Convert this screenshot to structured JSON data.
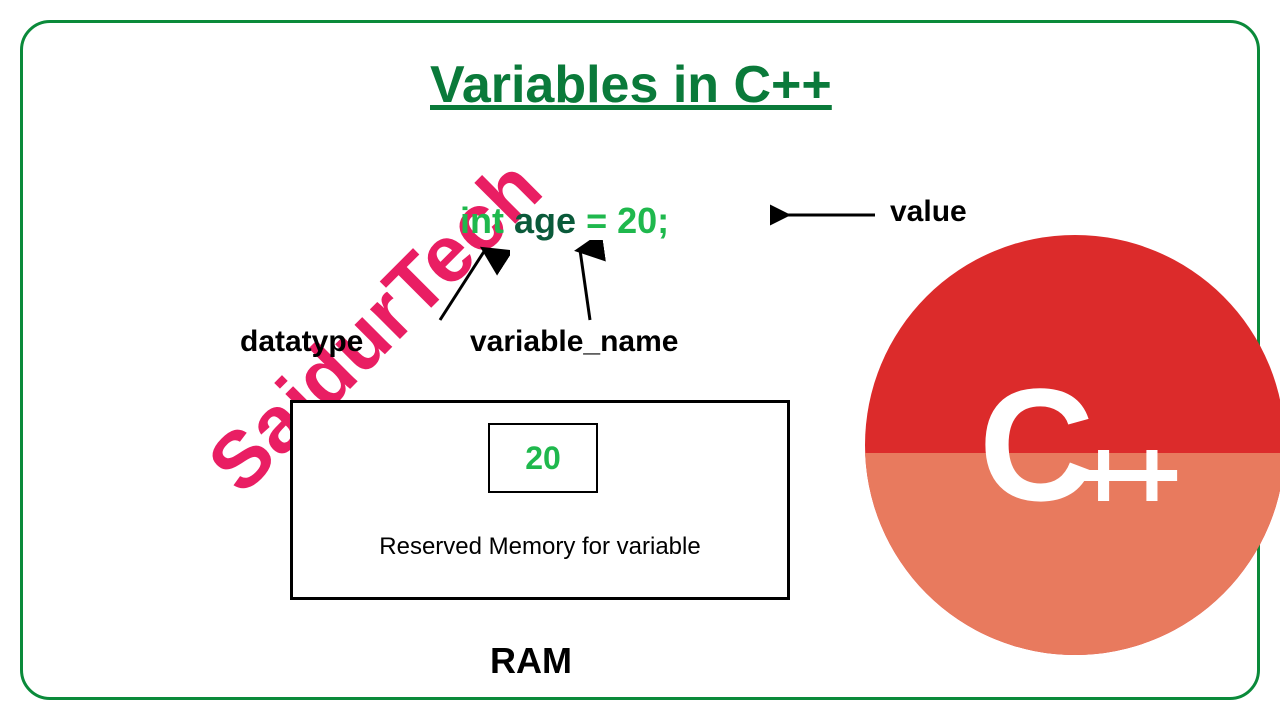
{
  "branding": {
    "watermark": "SaidurTech"
  },
  "title": "Variables in C++",
  "code": {
    "datatype": "int",
    "varname": "age",
    "equals": "=",
    "value_literal": "20",
    "terminator": ";"
  },
  "labels": {
    "datatype": "datatype",
    "variable_name": "variable_name",
    "value": "value"
  },
  "memory": {
    "cell_value": "20",
    "caption": "Reserved Memory for variable",
    "label": "RAM"
  },
  "logo": {
    "letter": "C",
    "suffix": "++"
  }
}
